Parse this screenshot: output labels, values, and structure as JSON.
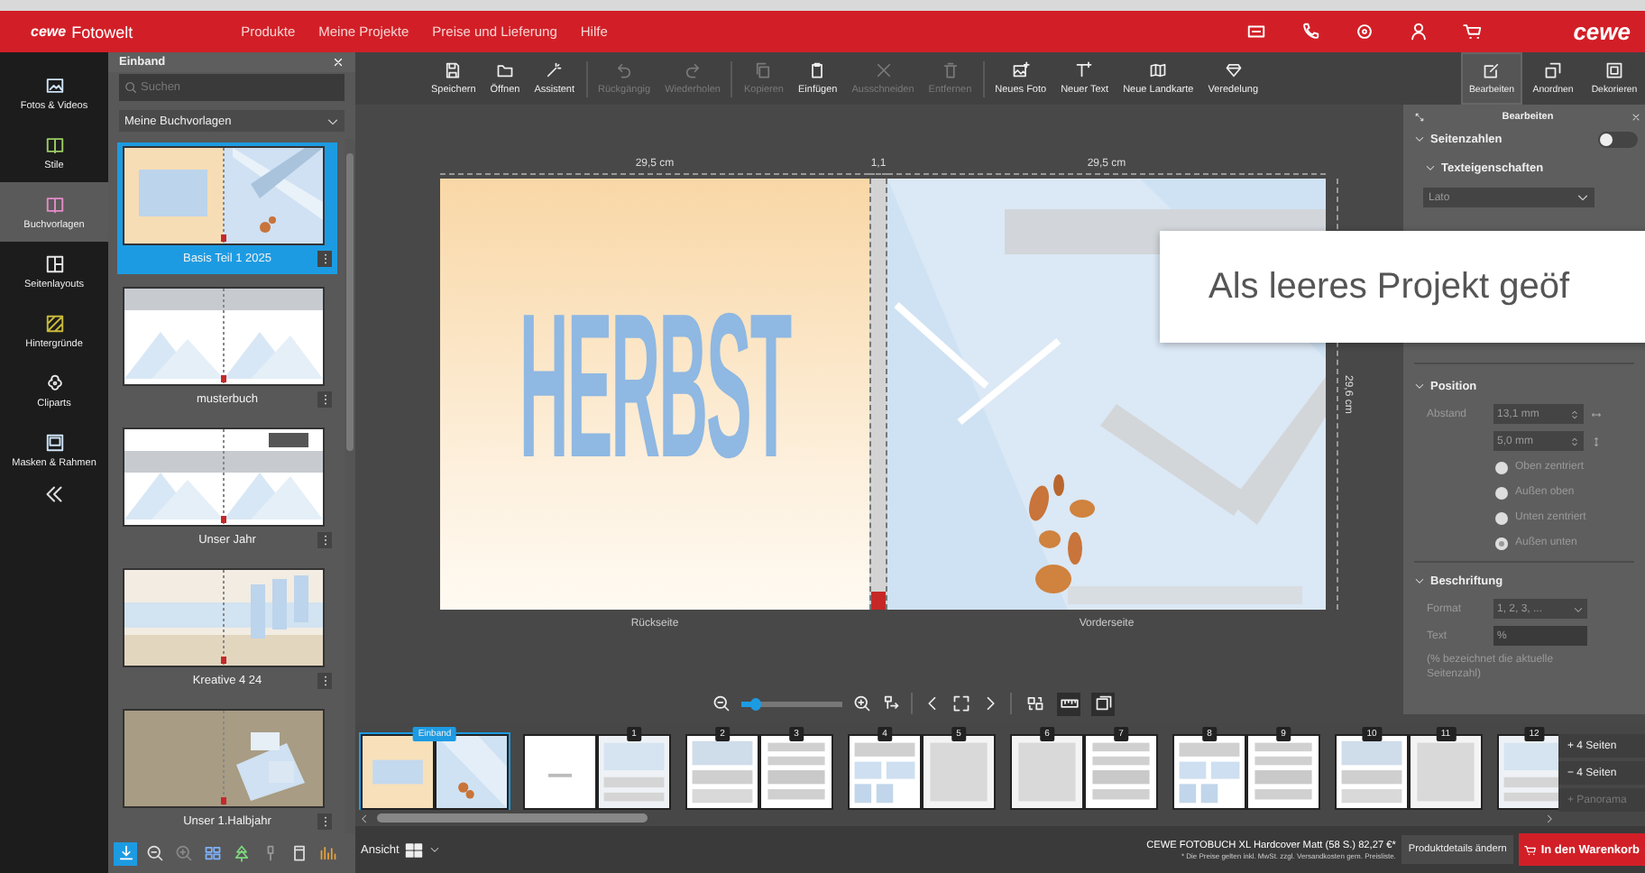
{
  "header": {
    "logo": "cewe",
    "app_name": "Fotowelt",
    "nav": [
      "Produkte",
      "Meine Projekte",
      "Preise und Lieferung",
      "Hilfe"
    ],
    "brand": "cewe"
  },
  "sidebar": [
    {
      "label": "Fotos & Videos",
      "selected": false
    },
    {
      "label": "Stile",
      "selected": false
    },
    {
      "label": "Buchvorlagen",
      "selected": true
    },
    {
      "label": "Seitenlayouts",
      "selected": false
    },
    {
      "label": "Hintergründe",
      "selected": false
    },
    {
      "label": "Cliparts",
      "selected": false
    },
    {
      "label": "Masken & Rahmen",
      "selected": false
    }
  ],
  "template_panel": {
    "title": "Einband",
    "search_placeholder": "Suchen",
    "filter": "Meine Buchvorlagen",
    "templates": [
      {
        "name": "Basis Teil 1 2025",
        "kind": "autumn",
        "selected": true
      },
      {
        "name": "musterbuch",
        "kind": "mountains",
        "selected": false
      },
      {
        "name": "Unser Jahr",
        "kind": "mountains-title",
        "selected": false
      },
      {
        "name": "Kreative 4 24",
        "kind": "collage",
        "selected": false
      },
      {
        "name": "Unser 1.Halbjahr",
        "kind": "tan",
        "selected": false
      }
    ],
    "tools": [
      {
        "selected": true
      },
      {
        "selected": false
      },
      {
        "selected": false
      },
      {
        "selected": false
      },
      {
        "selected": false
      },
      {
        "selected": false
      },
      {
        "selected": false
      },
      {
        "selected": false
      }
    ]
  },
  "toolbar": [
    {
      "label": "Speichern",
      "disabled": false
    },
    {
      "label": "Öffnen",
      "disabled": false
    },
    {
      "label": "Assistent",
      "disabled": false
    },
    {
      "label": "Rückgängig",
      "disabled": true
    },
    {
      "label": "Wiederholen",
      "disabled": true
    },
    {
      "label": "Kopieren",
      "disabled": true
    },
    {
      "label": "Einfügen",
      "disabled": false
    },
    {
      "label": "Ausschneiden",
      "disabled": true
    },
    {
      "label": "Entfernen",
      "disabled": true
    },
    {
      "label": "Neues Foto",
      "disabled": false
    },
    {
      "label": "Neuer Text",
      "disabled": false
    },
    {
      "label": "Neue Landkarte",
      "disabled": false
    },
    {
      "label": "Veredelung",
      "disabled": false
    }
  ],
  "view_tabs": [
    {
      "label": "Bearbeiten",
      "selected": true
    },
    {
      "label": "Anordnen",
      "selected": false
    },
    {
      "label": "Dekorieren",
      "selected": false
    }
  ],
  "canvas": {
    "width_left": "29,5 cm",
    "spine": "1,1",
    "width_right": "29,5 cm",
    "height": "29,6 cm",
    "cover_title": "HERBST",
    "back_label": "Rückseite",
    "front_label": "Vorderseite"
  },
  "canvas_controls": {
    "zoom": {
      "level": 0.15
    },
    "toggles": [
      {
        "on": false
      },
      {
        "on": true
      },
      {
        "on": true
      }
    ]
  },
  "properties_panel": {
    "title": "Bearbeiten"
  },
  "page_numbers": {
    "label": "Seitenzahlen",
    "enabled": false,
    "text_properties": {
      "label": "Texteigenschaften",
      "font": "Lato"
    },
    "position": {
      "label": "Position",
      "spacing_label": "Abstand",
      "horizontal": "13,1 mm",
      "vertical": "5,0 mm",
      "options": [
        {
          "label": "Oben zentriert",
          "selected": false
        },
        {
          "label": "Außen oben",
          "selected": false
        },
        {
          "label": "Unten zentriert",
          "selected": false
        },
        {
          "label": "Außen unten",
          "selected": true
        }
      ]
    },
    "caption": {
      "label": "Beschriftung",
      "format_label": "Format",
      "format": "1, 2, 3, ...",
      "text_label": "Text",
      "text": "%",
      "hint": "(% bezeichnet die aktuelle Seitenzahl)"
    }
  },
  "toast": {
    "text": "Als leeres Projekt geöf"
  },
  "page_strip": {
    "spreads": [
      {
        "label": "Einband",
        "selected": true,
        "pages": [
          {
            "kind": "back-cover"
          },
          {
            "kind": "front-cover"
          }
        ]
      },
      {
        "selected": false,
        "pages": [
          {
            "kind": "blank"
          },
          {
            "kind": "photos",
            "number": "1"
          }
        ]
      },
      {
        "selected": false,
        "pages": [
          {
            "kind": "layout",
            "number": "2"
          },
          {
            "kind": "text",
            "number": "3"
          }
        ]
      },
      {
        "selected": false,
        "pages": [
          {
            "kind": "collage",
            "number": "4"
          },
          {
            "kind": "box",
            "number": "5"
          }
        ]
      },
      {
        "selected": false,
        "pages": [
          {
            "kind": "box",
            "number": "6"
          },
          {
            "kind": "text",
            "number": "7"
          }
        ]
      },
      {
        "selected": false,
        "pages": [
          {
            "kind": "collage",
            "number": "8"
          },
          {
            "kind": "text",
            "number": "9"
          }
        ]
      },
      {
        "selected": false,
        "pages": [
          {
            "kind": "layout",
            "number": "10"
          },
          {
            "kind": "box",
            "number": "11"
          }
        ]
      },
      {
        "selected": false,
        "pages": [
          {
            "kind": "photos",
            "number": "12"
          }
        ]
      }
    ],
    "buttons": [
      {
        "label": "+ 4 Seiten",
        "disabled": false
      },
      {
        "label": "− 4 Seiten",
        "disabled": false
      },
      {
        "label": "+ Panorama",
        "disabled": true
      }
    ]
  },
  "footer": {
    "view_label": "Ansicht",
    "product": "CEWE FOTOBUCH XL Hardcover Matt (58 S.) 82,27 €*",
    "price_note": "* Die Preise gelten inkl. MwSt. zzgl. Versandkosten gem. Preisliste.",
    "details_button": "Produktdetails ändern",
    "cart_button": "In den Warenkorb"
  }
}
